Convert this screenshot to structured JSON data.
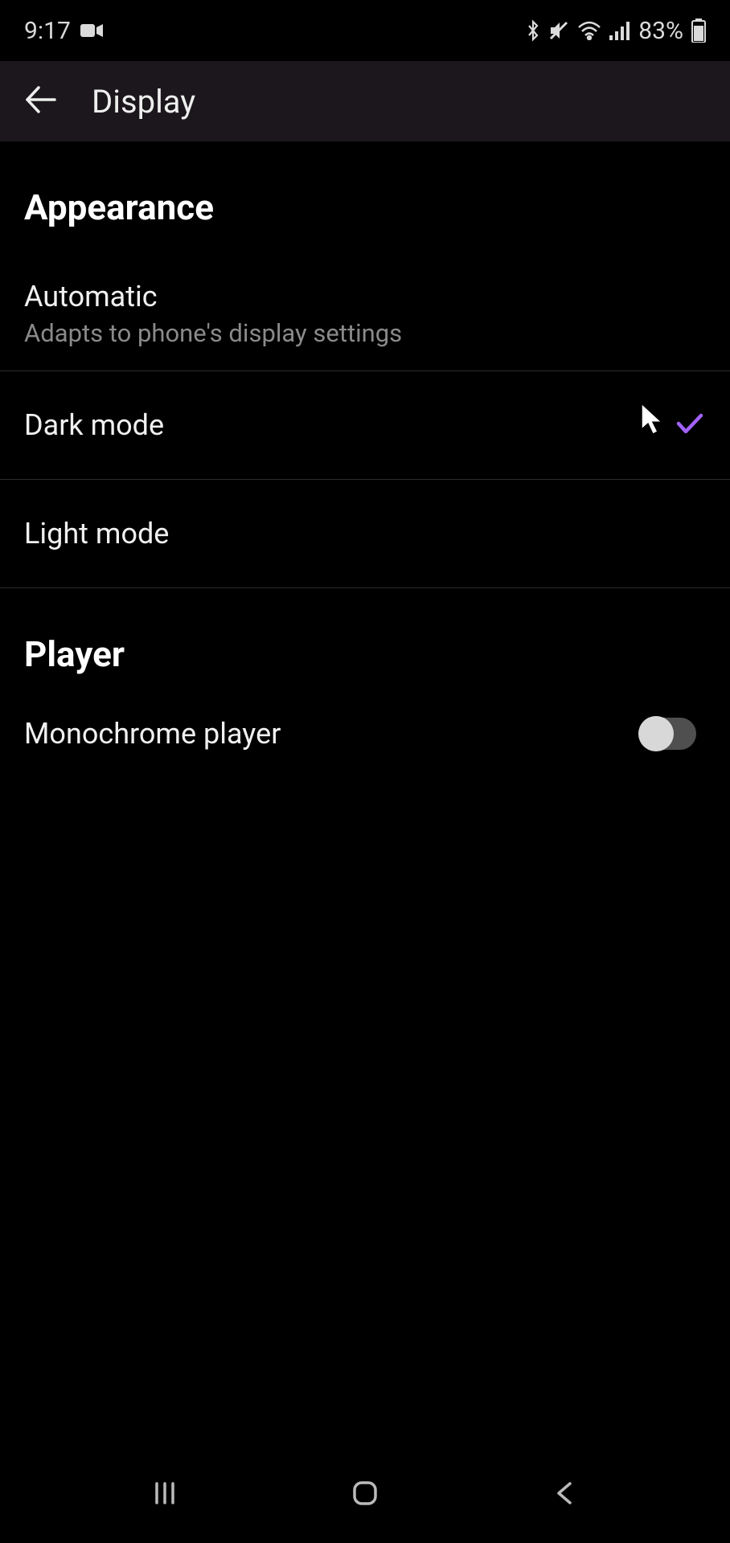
{
  "status_bar": {
    "time": "9:17",
    "battery_percent": "83%"
  },
  "app_bar": {
    "title": "Display"
  },
  "sections": {
    "appearance": {
      "header": "Appearance",
      "automatic": {
        "title": "Automatic",
        "subtitle": "Adapts to phone's display settings"
      },
      "dark_mode": {
        "title": "Dark mode",
        "selected": true
      },
      "light_mode": {
        "title": "Light mode",
        "selected": false
      }
    },
    "player": {
      "header": "Player",
      "monochrome": {
        "title": "Monochrome player",
        "enabled": false
      }
    }
  },
  "accent_color": "#a362ff"
}
